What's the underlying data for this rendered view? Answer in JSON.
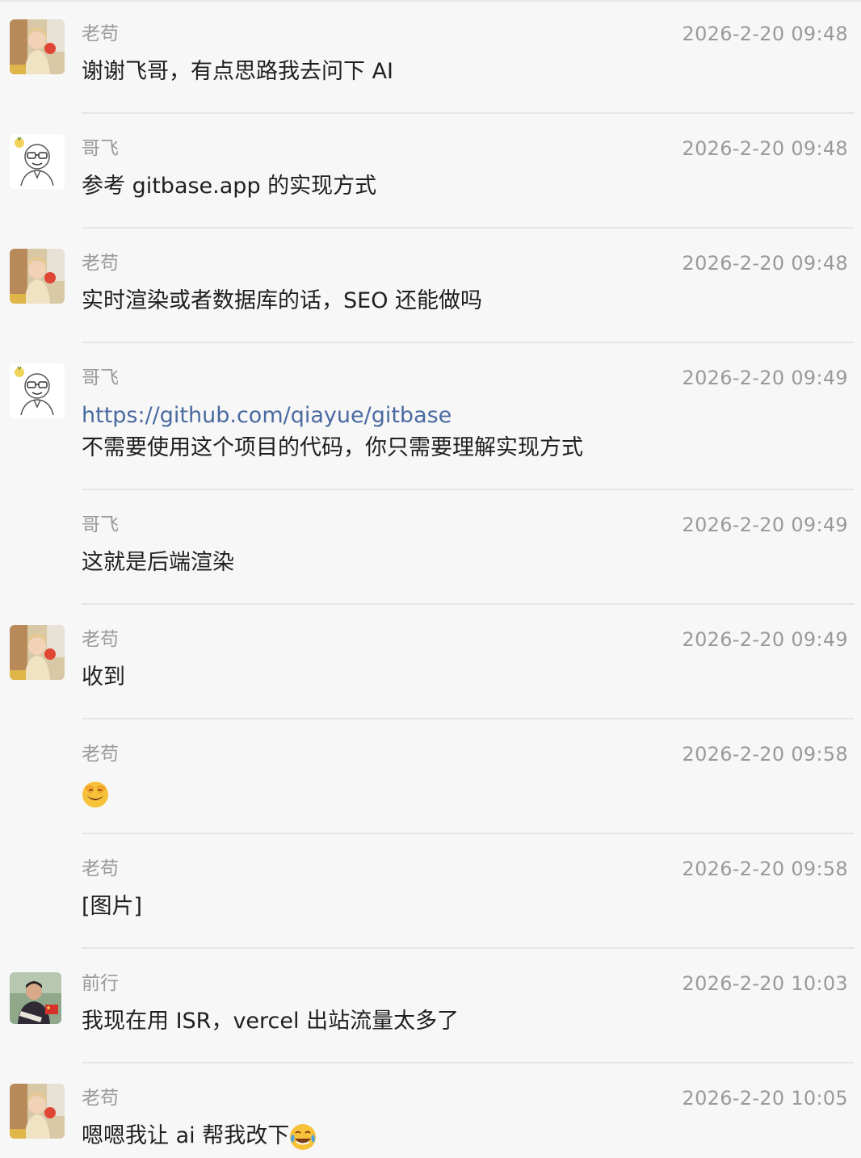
{
  "messages": [
    {
      "sender": "老苟",
      "time": "2026-2-20 09:48",
      "text": "谢谢飞哥，有点思路我去问下 AI",
      "avatar": "girl-avatar"
    },
    {
      "sender": "哥飞",
      "time": "2026-2-20 09:48",
      "text": "参考 gitbase.app 的实现方式",
      "avatar": "cartoon-man-avatar"
    },
    {
      "sender": "老苟",
      "time": "2026-2-20 09:48",
      "text": "实时渲染或者数据库的话，SEO 还能做吗",
      "avatar": "girl-avatar"
    },
    {
      "sender": "哥飞",
      "time": "2026-2-20 09:49",
      "link": "https://github.com/qiayue/gitbase",
      "text": "不需要使用这个项目的代码，你只需要理解实现方式",
      "avatar": "cartoon-man-avatar"
    },
    {
      "sender": "哥飞",
      "time": "2026-2-20 09:49",
      "text": "这就是后端渲染"
    },
    {
      "sender": "老苟",
      "time": "2026-2-20 09:49",
      "text": "收到",
      "avatar": "girl-avatar"
    },
    {
      "sender": "老苟",
      "time": "2026-2-20 09:58",
      "emoji": "face-palm-laugh-emoji"
    },
    {
      "sender": "老苟",
      "time": "2026-2-20 09:58",
      "text": "[图片]"
    },
    {
      "sender": "前行",
      "time": "2026-2-20 10:03",
      "text": "我现在用 ISR，vercel 出站流量太多了",
      "avatar": "man-photo-avatar"
    },
    {
      "sender": "老苟",
      "time": "2026-2-20 10:05",
      "text": "嗯嗯我让 ai 帮我改下",
      "emoji": "tears-of-joy-emoji",
      "avatar": "girl-avatar"
    }
  ],
  "colors": {
    "background": "#f7f7f7",
    "text": "#1f1f1f",
    "meta": "#9a9a9a",
    "link": "#4a6aa0",
    "divider": "#e6e6e6"
  }
}
